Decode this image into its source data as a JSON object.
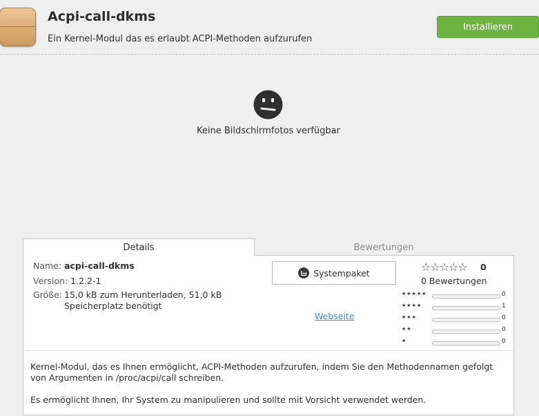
{
  "header": {
    "app_name": "Acpi-call-dkms",
    "summary": "Ein Kernel-Modul das es erlaubt ACPI-Methoden aufzurufen",
    "install_label": "Installieren",
    "icon": "package-box-icon"
  },
  "screenshots": {
    "icon": "sad-face-icon",
    "empty_text": "Keine Bildschirmfotos verfügbar"
  },
  "tabs": {
    "details_label": "Details",
    "reviews_label": "Bewertungen"
  },
  "details": {
    "name_label": "Name:",
    "name_value": "acpi-call-dkms",
    "version_label": "Version:",
    "version_value": "1.2.2-1",
    "size_label": "Größe:",
    "size_line1": "15,0 kB zum Herunterladen, 51,0 kB",
    "size_line2": "Speicherplatz benötigt",
    "package_type_label": "Systempaket",
    "package_icon": "mint-logo-icon",
    "website_label": "Webseite"
  },
  "ratings": {
    "stars_display": "☆☆☆☆☆",
    "score": "0",
    "total_label": "0 Bewertungen",
    "rows": [
      {
        "stars": "★★★★★",
        "count": "0",
        "fraction": 0
      },
      {
        "stars": "★★★★",
        "count": "1",
        "fraction": 0
      },
      {
        "stars": "★★★",
        "count": "0",
        "fraction": 0
      },
      {
        "stars": "★★",
        "count": "0",
        "fraction": 0
      },
      {
        "stars": "★",
        "count": "0",
        "fraction": 0
      }
    ]
  },
  "description": {
    "paragraph1": "Kernel-Modul, das es Ihnen ermöglicht, ACPI-Methoden aufzurufen, indem Sie den Methodennamen gefolgt von Argumenten in /proc/acpi/call schreiben.",
    "paragraph2": "Es ermöglicht Ihnen, Ihr System zu manipulieren und sollte mit Vorsicht verwendet werden."
  },
  "colors": {
    "install_button": "#6db442",
    "link": "#4a8ac9"
  }
}
